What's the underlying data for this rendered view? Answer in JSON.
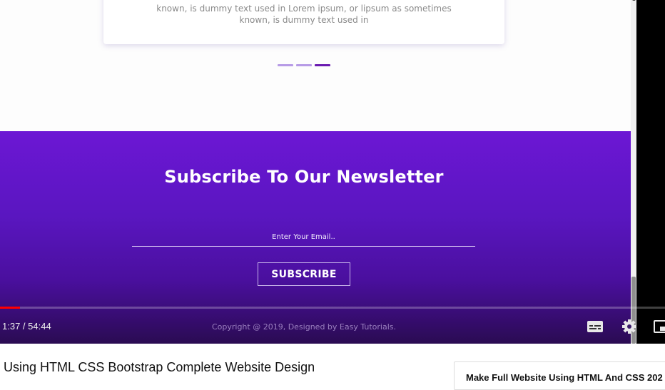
{
  "testimonial": {
    "text_line1": "known, is dummy text used in Lorem ipsum, or lipsum as sometimes",
    "text_line2": "known, is dummy text used in"
  },
  "carousel": {
    "dots": 3,
    "active_index": 2,
    "dot_color": "#b79be6",
    "active_color": "#6a1ab0"
  },
  "newsletter": {
    "title": "Subscribe To Our Newsletter",
    "email_placeholder": "Enter Your Email..",
    "subscribe_label": "SUBSCRIBE",
    "gradient_top": "#6c17d4",
    "gradient_bottom": "#2a0b52"
  },
  "footer": {
    "copyright": "Copyright @ 2019, Designed by Easy Tutorials."
  },
  "player": {
    "time": "1:37 / 54:44",
    "progress": 0.0297,
    "icons": [
      "subtitles-icon",
      "settings-icon",
      "miniplayer-icon"
    ]
  },
  "video": {
    "title": "Using HTML CSS Bootstrap Complete Website Design"
  },
  "side_card": {
    "title": "Make Full Website Using HTML And CSS 202"
  }
}
